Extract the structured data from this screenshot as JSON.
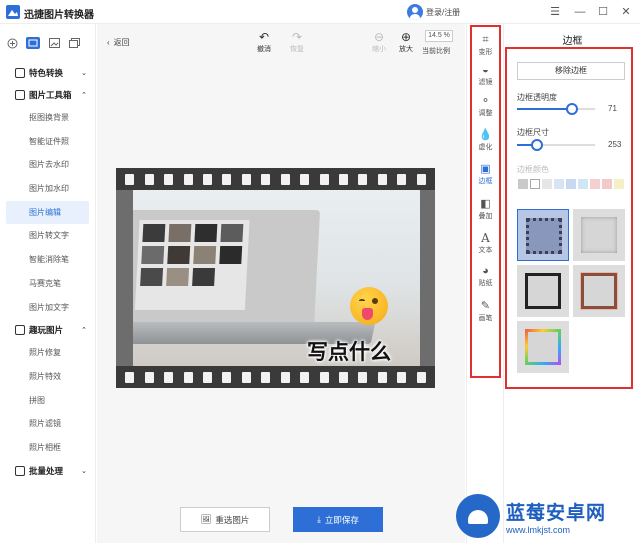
{
  "app": {
    "title": "迅捷图片转换器",
    "login": "登录/注册"
  },
  "window": {
    "menu_icon": "menu-icon",
    "minimize_icon": "minimize-icon",
    "maximize_icon": "maximize-icon",
    "close_icon": "close-icon"
  },
  "sidebar": {
    "groups": [
      {
        "label": "特色转换"
      },
      {
        "label": "图片工具箱",
        "items": [
          "抠图换背景",
          "智能证件照",
          "图片去水印",
          "图片加水印",
          "图片编辑",
          "图片转文字",
          "智能消除笔",
          "马赛克笔",
          "图片加文字"
        ]
      },
      {
        "label": "趣玩图片",
        "items": [
          "照片修复",
          "照片特效",
          "拼图",
          "照片滤镜",
          "照片相框"
        ]
      },
      {
        "label": "批量处理"
      }
    ],
    "active_item": "图片编辑"
  },
  "toolbar": {
    "back": "返回",
    "undo": "撤消",
    "redo": "恢复",
    "zoom_out": "缩小",
    "zoom_in": "放大",
    "zoom_value": "14.5 %",
    "actual_ratio": "当前比例"
  },
  "canvas": {
    "caption": "写点什么"
  },
  "bottom": {
    "reselect": "重选图片",
    "save": "立即保存"
  },
  "tools": [
    "变形",
    "滤镜",
    "调整",
    "虚化",
    "边框",
    "叠加",
    "文本",
    "贴纸",
    "画笔"
  ],
  "active_tool": "边框",
  "panel": {
    "title": "边框",
    "remove": "移除边框",
    "opacity_label": "边框透明度",
    "opacity_value": "71",
    "opacity_fraction": 0.71,
    "size_label": "边框尺寸",
    "size_value": "253",
    "size_fraction": 0.25,
    "color_label": "边框颜色",
    "swatches": [
      "#c9c9c9",
      "#ffffff",
      "#e6e6e6",
      "#d8e4f5",
      "#c8d8f0",
      "#cfe6f5",
      "#f5d0d0",
      "#f3c9c9",
      "#f5efc8"
    ]
  },
  "watermark": {
    "brand": "蓝莓安卓网",
    "url": "www.lmkjst.com"
  }
}
